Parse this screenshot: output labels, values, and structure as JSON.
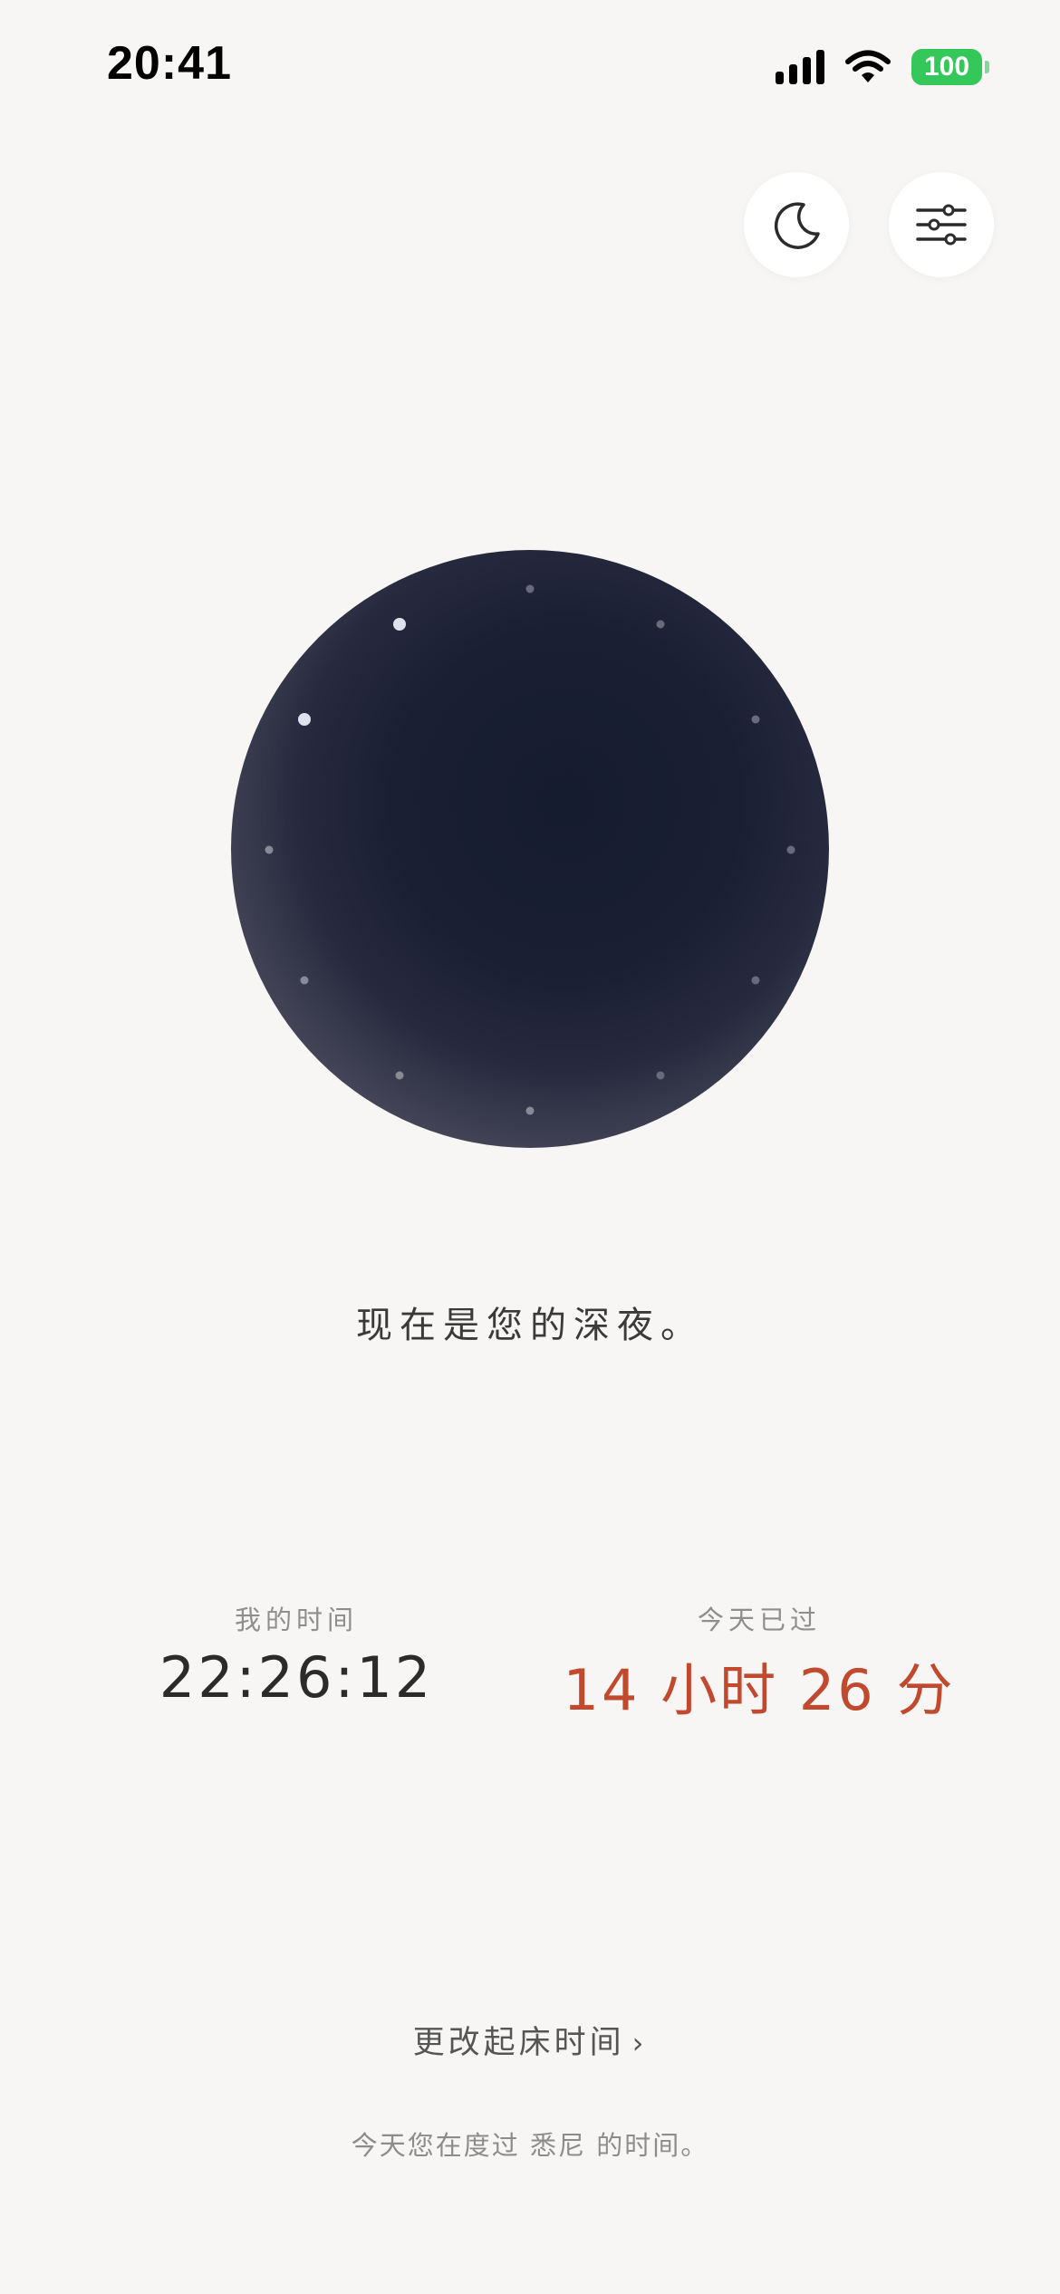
{
  "status_bar": {
    "time": "20:41",
    "battery": "100",
    "icons": [
      "signal-icon",
      "wifi-icon",
      "battery-icon"
    ]
  },
  "top_buttons": {
    "night_icon": "moon-icon",
    "settings_icon": "sliders-icon"
  },
  "message": "现在是您的深夜。",
  "my_time": {
    "label": "我的时间",
    "value": "22:26:12"
  },
  "elapsed": {
    "label": "今天已过",
    "value": "14 小时 26 分"
  },
  "change_wake": {
    "label": "更改起床时间",
    "chevron": "›"
  },
  "footer_note": "今天您在度过 悉尼 的时间。",
  "colors": {
    "background": "#f7f6f4",
    "accent": "#c0492e",
    "battery": "#34c759",
    "dial_core": "#161c30"
  }
}
